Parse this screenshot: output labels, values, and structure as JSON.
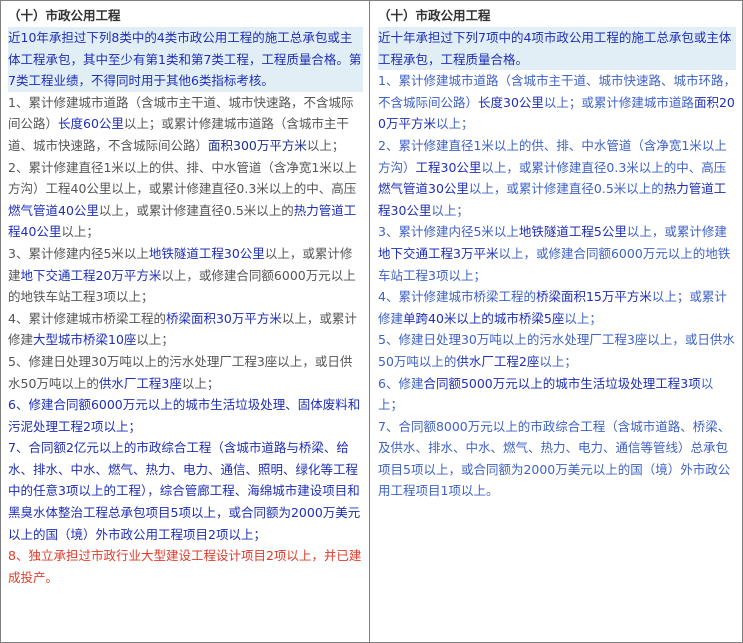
{
  "left": {
    "title": "（十）市政公用工程",
    "intro": "近10年承担过下列8类中的4类市政公用工程的施工总承包或主体工程承包，其中至少有第1类和第7类工程，工程质量合格。第7类工程业绩，不得同时用于其他6类指标考核。",
    "items": [
      {
        "a": "1、累计修建城市道路（含城市主干道、城市快速路，不含城际间公路）",
        "b": "长度60公里",
        "c": "以上；或累计修建城市道路（含城市主干道、城市快速路，不含城际间公路）",
        "d": "面积300万平方米",
        "e": "以上；"
      },
      {
        "a": "2、累计修建直径1米以上的供、排、中水管道（含净宽1米以上方沟）工程40公里以上，或累计修建直径0.3米以上的中、高压",
        "b": "燃气管道40公里",
        "c": "以上，或累计修建直径0.5米以上的",
        "d": "热力管道工程40公里",
        "e": "以上；"
      },
      {
        "a": "3、累计修建内径5米以上",
        "b": "地铁隧道工程30公里",
        "c": "以上，或累计修建",
        "d": "地下交通工程20万平方米",
        "e": "以上，或修建合同额6000万元以上的地铁车站工程3项以上；"
      },
      {
        "a": "4、累计修建城市桥梁工程的",
        "b": "桥梁面积30万平方米",
        "c": "以上，或累计修建",
        "d": "大型城市桥梁10座",
        "e": "以上；"
      },
      {
        "a": "5、修建日处理30万吨以上的污水处理厂工程3座以上，或日供水50万吨以上的",
        "b": "供水厂工程3座",
        "c": "以上；",
        "d": "",
        "e": ""
      },
      {
        "a": "6、修建合同额6000万元以上的城市生活垃圾处理、固体废料和污泥处理工程2项以上；"
      },
      {
        "a": "7、合同额2亿元以上的市政综合工程（含城市道路与桥梁、给水、排水、中水、燃气、热力、电力、通信、照明、绿化等工程中的任意3项以上的工程），综合管廊工程、海绵城市建设项目和黑臭水体整治工程总承包项目5项以上，或合同额为2000万美元以上的国（境）外市政公用工程项目2项以上；"
      },
      {
        "a": "8、独立承担过市政行业大型建设工程设计项目2项以上，并已建成投产。"
      }
    ]
  },
  "right": {
    "title": "（十）市政公用工程",
    "intro": "近十年承担过下列7项中的4项市政公用工程的施工总承包或主体工程承包，工程质量合格。",
    "items": [
      {
        "a": "1、累计修建城市道路（含城市主干道、城市快速路、城市环路，不含城际间公路）",
        "b": "长度30公里",
        "c": "以上；或累计修建城市道路",
        "d": "面积200万平方米",
        "e": "以上；"
      },
      {
        "a": "2、累计修建直径1米以上的供、排、中水管道（含净宽1米以上方沟）",
        "b": "工程30公里",
        "c": "以上，或累计修建直径0.3米以上的中、高压",
        "d": "燃气管道30公里",
        "e": "以上，或累计修建直径0.5米以上的",
        "f": "热力管道工程30公里",
        "g": "以上；"
      },
      {
        "a": "3、累计修建内径5米以上",
        "b": "地铁隧道工程5公里",
        "c": "以上，或累计修建",
        "d": "地下交通工程3万平米",
        "e": "以上，或修建合同额6000万元以上的地铁车站工程3项以上；"
      },
      {
        "a": "4、累计修建城市桥梁工程的",
        "b": "桥梁面积15万平方米",
        "c": "以上；或累计修建",
        "d": "单跨40米以上的城市桥梁5座",
        "e": "以上；"
      },
      {
        "a": "5、修建日处理30万吨以上的污水处理厂工程3座以上，或日供水50万吨以上的",
        "b": "供水厂工程2座",
        "c": "以上；"
      },
      {
        "a": "6、修建",
        "b": "合同额5000万元以上的城市生活垃圾处理工程3项",
        "c": "以上；"
      },
      {
        "a": "7、合同额8000万元以上的市政综合工程（含城市道路、桥梁、及供水、排水、中水、燃气、热力、电力、通信等管线）总承包项目5项以上，或合同额为2000万美元以上的国（境）外市政公用工程项目1项以上。"
      }
    ]
  }
}
